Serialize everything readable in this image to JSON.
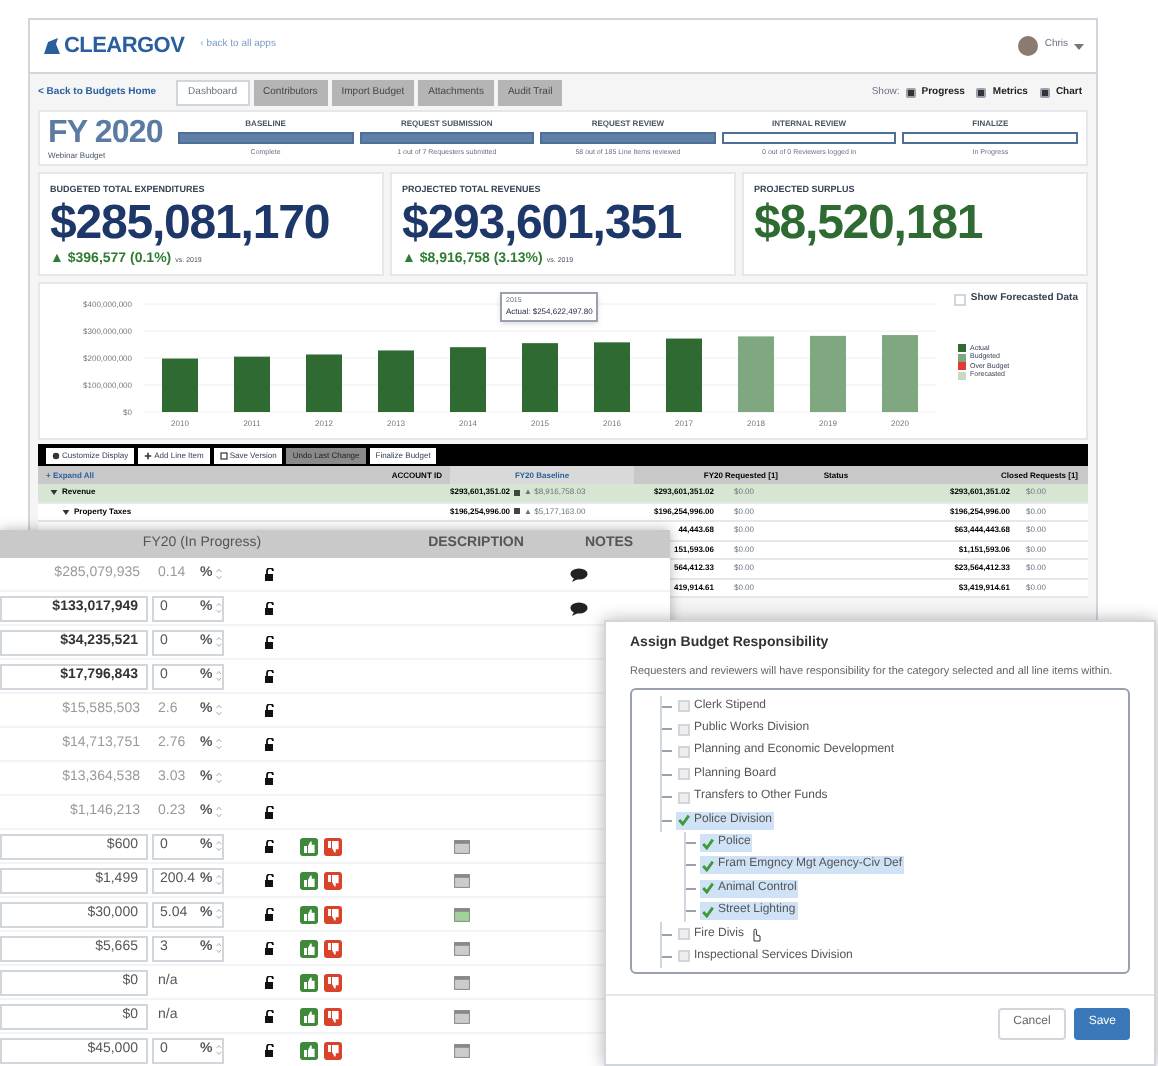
{
  "header": {
    "logo": "CLEARGOV",
    "back_link": "‹ back to all apps",
    "user": "Chris"
  },
  "nav": {
    "back_link": "< Back to Budgets Home",
    "tabs": [
      {
        "label": "Dashboard",
        "selected": true
      },
      {
        "label": "Contributors",
        "selected": false
      },
      {
        "label": "Import Budget",
        "selected": false
      },
      {
        "label": "Attachments",
        "selected": false
      },
      {
        "label": "Audit Trail",
        "selected": false
      }
    ],
    "show_label": "Show:",
    "toggles": [
      {
        "label": "Progress",
        "checked": true
      },
      {
        "label": "Metrics",
        "checked": true
      },
      {
        "label": "Chart",
        "checked": true
      }
    ]
  },
  "budget": {
    "title": "FY 2020",
    "subtitle": "Webinar Budget",
    "stages": [
      {
        "label": "BASELINE",
        "complete": true,
        "caption": "Complete"
      },
      {
        "label": "REQUEST SUBMISSION",
        "complete": true,
        "caption": "1 out of 7 Requesters submitted"
      },
      {
        "label": "REQUEST REVIEW",
        "complete": true,
        "caption": "58 out of 185 Line Items reviewed"
      },
      {
        "label": "INTERNAL REVIEW",
        "complete": false,
        "caption": "0 out of 0 Reviewers logged in"
      },
      {
        "label": "FINALIZE",
        "complete": false,
        "caption": "In Progress"
      }
    ]
  },
  "metrics": [
    {
      "label": "BUDGETED TOTAL EXPENDITURES",
      "value": "$285,081,170",
      "change": "▲ $396,577 (0.1%)",
      "comparison": "vs. 2019",
      "color": "#1d3768"
    },
    {
      "label": "PROJECTED TOTAL REVENUES",
      "value": "$293,601,351",
      "change": "▲ $8,916,758 (3.13%)",
      "comparison": "vs. 2019",
      "color": "#1d3768"
    },
    {
      "label": "PROJECTED SURPLUS",
      "value": "$8,520,181",
      "color": "#2e6a31"
    }
  ],
  "chart": {
    "show_forecasted": {
      "label": "Show Forecasted Data",
      "checked": false
    },
    "tooltip": {
      "title": "2015",
      "text": "Actual: $254,622,497.80"
    },
    "chart_data": {
      "type": "bar",
      "stacked": true,
      "grid": true,
      "legend": "right",
      "categories": [
        "2010",
        "2011",
        "2012",
        "2013",
        "2014",
        "2015",
        "2016",
        "2017",
        "2018",
        "2019",
        "2020"
      ],
      "ylim": [
        0,
        400000000
      ],
      "yticks": [
        {
          "value": 0,
          "label": "$0"
        },
        {
          "value": 100000000,
          "label": "$100,000,000"
        },
        {
          "value": 200000000,
          "label": "$200,000,000"
        },
        {
          "value": 300000000,
          "label": "$300,000,000"
        },
        {
          "value": 400000000,
          "label": "$400,000,000"
        }
      ],
      "series": [
        {
          "name": "Actual",
          "color": "#2e6a31",
          "values": [
            198000000,
            205000000,
            213000000,
            228000000,
            240000000,
            255000000,
            258000000,
            272000000,
            null,
            null,
            null
          ]
        },
        {
          "name": "Budgeted",
          "color": "#7fa880",
          "values": [
            null,
            null,
            null,
            null,
            null,
            null,
            null,
            null,
            280000000,
            282000000,
            285000000
          ]
        },
        {
          "name": "Over Budget",
          "color": "#e53935",
          "values": [
            null,
            null,
            null,
            null,
            null,
            null,
            null,
            null,
            null,
            null,
            null
          ]
        },
        {
          "name": "Forecasted",
          "color": "#c9d9c5",
          "values": [
            null,
            null,
            null,
            null,
            null,
            null,
            null,
            null,
            null,
            null,
            null
          ]
        }
      ]
    }
  },
  "toolbar": [
    {
      "label": "Customize Display",
      "disabled": false
    },
    {
      "label": "Add Line Item",
      "disabled": false
    },
    {
      "label": "Save Version",
      "disabled": false
    },
    {
      "label": "Undo Last Change",
      "disabled": true
    },
    {
      "label": "Finalize Budget",
      "disabled": false
    }
  ],
  "table": {
    "expand_all": "+ Expand All",
    "columns": [
      "ACCOUNT ID",
      "FY20 Baseline",
      "FY20 Requested [1]",
      "Status",
      "Closed Requests [1]"
    ],
    "rows": [
      {
        "label": "Revenue",
        "expanded": true,
        "baseline": "$293,601,351.02",
        "baseline_change": "▲ $8,916,758.03",
        "requested": "$293,601,351.02",
        "requested_change": "$0.00",
        "closed": "$293,601,351.02",
        "closed_change": "$0.00",
        "children": [
          {
            "label": "Property Taxes",
            "expanded": true,
            "baseline": "$196,254,996.00",
            "baseline_change": "▲ $5,177,163.00",
            "requested": "$196,254,996.00",
            "requested_change": "$0.00",
            "closed": "$196,254,996.00",
            "closed_change": "$0.00",
            "children": [
              {
                "requested": "44,443.68",
                "requested_change": "$0.00",
                "closed": "$63,444,443.68",
                "closed_change": "$0.00"
              },
              {
                "requested": "151,593.06",
                "requested_change": "$0.00",
                "closed": "$1,151,593.06",
                "closed_change": "$0.00"
              },
              {
                "requested": "564,412.33",
                "requested_change": "$0.00",
                "closed": "$23,564,412.33",
                "closed_change": "$0.00"
              },
              {
                "requested": "419,914.61",
                "requested_change": "$0.00",
                "closed": "$3,419,914.61",
                "closed_change": "$0.00"
              }
            ]
          }
        ]
      }
    ]
  },
  "editor": {
    "columns": [
      "FY20 (In Progress)",
      "DESCRIPTION",
      "NOTES"
    ],
    "rows": [
      {
        "kind": "total",
        "amount": "$285,079,935",
        "pct": "0.14",
        "unit": "%",
        "has_note": true
      },
      {
        "kind": "group",
        "amount": "$133,017,949",
        "pct": "0",
        "unit": "%",
        "has_note": true
      },
      {
        "kind": "group",
        "amount": "$34,235,521",
        "pct": "0",
        "unit": "%"
      },
      {
        "kind": "group",
        "amount": "$17,796,843",
        "pct": "0",
        "unit": "%"
      },
      {
        "kind": "total",
        "amount": "$15,585,503",
        "pct": "2.6",
        "unit": "%"
      },
      {
        "kind": "total",
        "amount": "$14,713,751",
        "pct": "2.76",
        "unit": "%"
      },
      {
        "kind": "total",
        "amount": "$13,364,538",
        "pct": "3.03",
        "unit": "%"
      },
      {
        "kind": "total",
        "amount": "$1,146,213",
        "pct": "0.23",
        "unit": "%"
      },
      {
        "kind": "line",
        "amount": "$600",
        "pct": "0",
        "unit": "%",
        "has_description": false
      },
      {
        "kind": "line",
        "amount": "$1,499",
        "pct": "200.4",
        "unit": "%",
        "has_description": false
      },
      {
        "kind": "line",
        "amount": "$30,000",
        "pct": "5.04",
        "unit": "%",
        "has_description": true
      },
      {
        "kind": "line",
        "amount": "$5,665",
        "pct": "3",
        "unit": "%",
        "has_description": false
      },
      {
        "kind": "line",
        "amount": "$0",
        "pct": "n/a",
        "has_description": false
      },
      {
        "kind": "line",
        "amount": "$0",
        "pct": "n/a",
        "has_description": false
      },
      {
        "kind": "line",
        "amount": "$45,000",
        "pct": "0",
        "unit": "%",
        "has_description": false
      }
    ]
  },
  "dialog": {
    "title": "Assign Budget Responsibility",
    "description": "Requesters and reviewers will have responsibility for the category selected and all line items within.",
    "tree": [
      {
        "label": "Clerk Stipend",
        "checked": false,
        "selected": false
      },
      {
        "label": "Public Works Division",
        "checked": false,
        "selected": false
      },
      {
        "label": "Planning and Economic Development",
        "checked": false,
        "selected": false
      },
      {
        "label": "Planning Board",
        "checked": false,
        "selected": false
      },
      {
        "label": "Transfers to Other Funds",
        "checked": false,
        "selected": false
      },
      {
        "label": "Police Division",
        "checked": true,
        "selected": true,
        "expanded": true,
        "children": [
          {
            "label": "Police",
            "checked": true,
            "selected": true
          },
          {
            "label": "Fram Emgncy Mgt Agency-Civ Def",
            "checked": true,
            "selected": true
          },
          {
            "label": "Animal Control",
            "checked": true,
            "selected": true
          },
          {
            "label": "Street Lighting",
            "checked": true,
            "selected": true
          }
        ]
      },
      {
        "label": "Fire Divis",
        "checked": false,
        "selected": false,
        "cursor": true
      },
      {
        "label": "Inspectional Services Division",
        "checked": false,
        "selected": false
      }
    ],
    "buttons": [
      {
        "label": "Cancel",
        "primary": false
      },
      {
        "label": "Save",
        "primary": true
      }
    ]
  }
}
